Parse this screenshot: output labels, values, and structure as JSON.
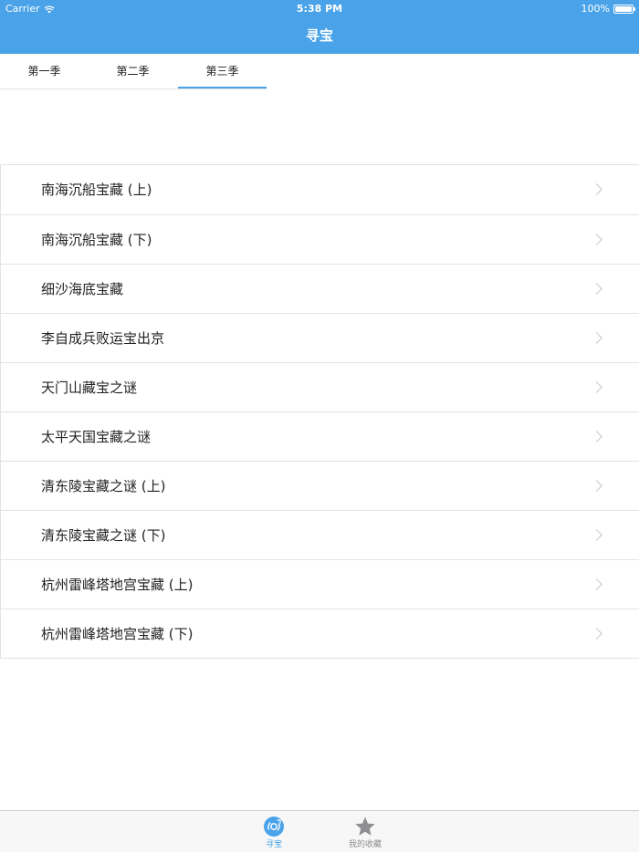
{
  "status_bar": {
    "carrier": "Carrier",
    "time": "5:38 PM",
    "battery": "100%"
  },
  "nav": {
    "title": "寻宝"
  },
  "tabs": [
    {
      "label": "第一季",
      "active": false
    },
    {
      "label": "第二季",
      "active": false
    },
    {
      "label": "第三季",
      "active": true
    }
  ],
  "list": [
    {
      "title": "南海沉船宝藏 (上)"
    },
    {
      "title": "南海沉船宝藏 (下)"
    },
    {
      "title": "细沙海底宝藏"
    },
    {
      "title": "李自成兵败运宝出京"
    },
    {
      "title": "天门山藏宝之谜"
    },
    {
      "title": "太平天国宝藏之谜"
    },
    {
      "title": "清东陵宝藏之谜 (上)"
    },
    {
      "title": "清东陵宝藏之谜 (下)"
    },
    {
      "title": "杭州雷峰塔地宫宝藏 (上)"
    },
    {
      "title": "杭州雷峰塔地宫宝藏 (下)"
    }
  ],
  "tabbar": [
    {
      "label": "寻宝",
      "icon": "treasure-disc-icon",
      "active": true
    },
    {
      "label": "我的收藏",
      "icon": "star-icon",
      "active": false
    }
  ],
  "colors": {
    "accent": "#4aa3e8",
    "tab_inactive": "#8e8e93"
  }
}
